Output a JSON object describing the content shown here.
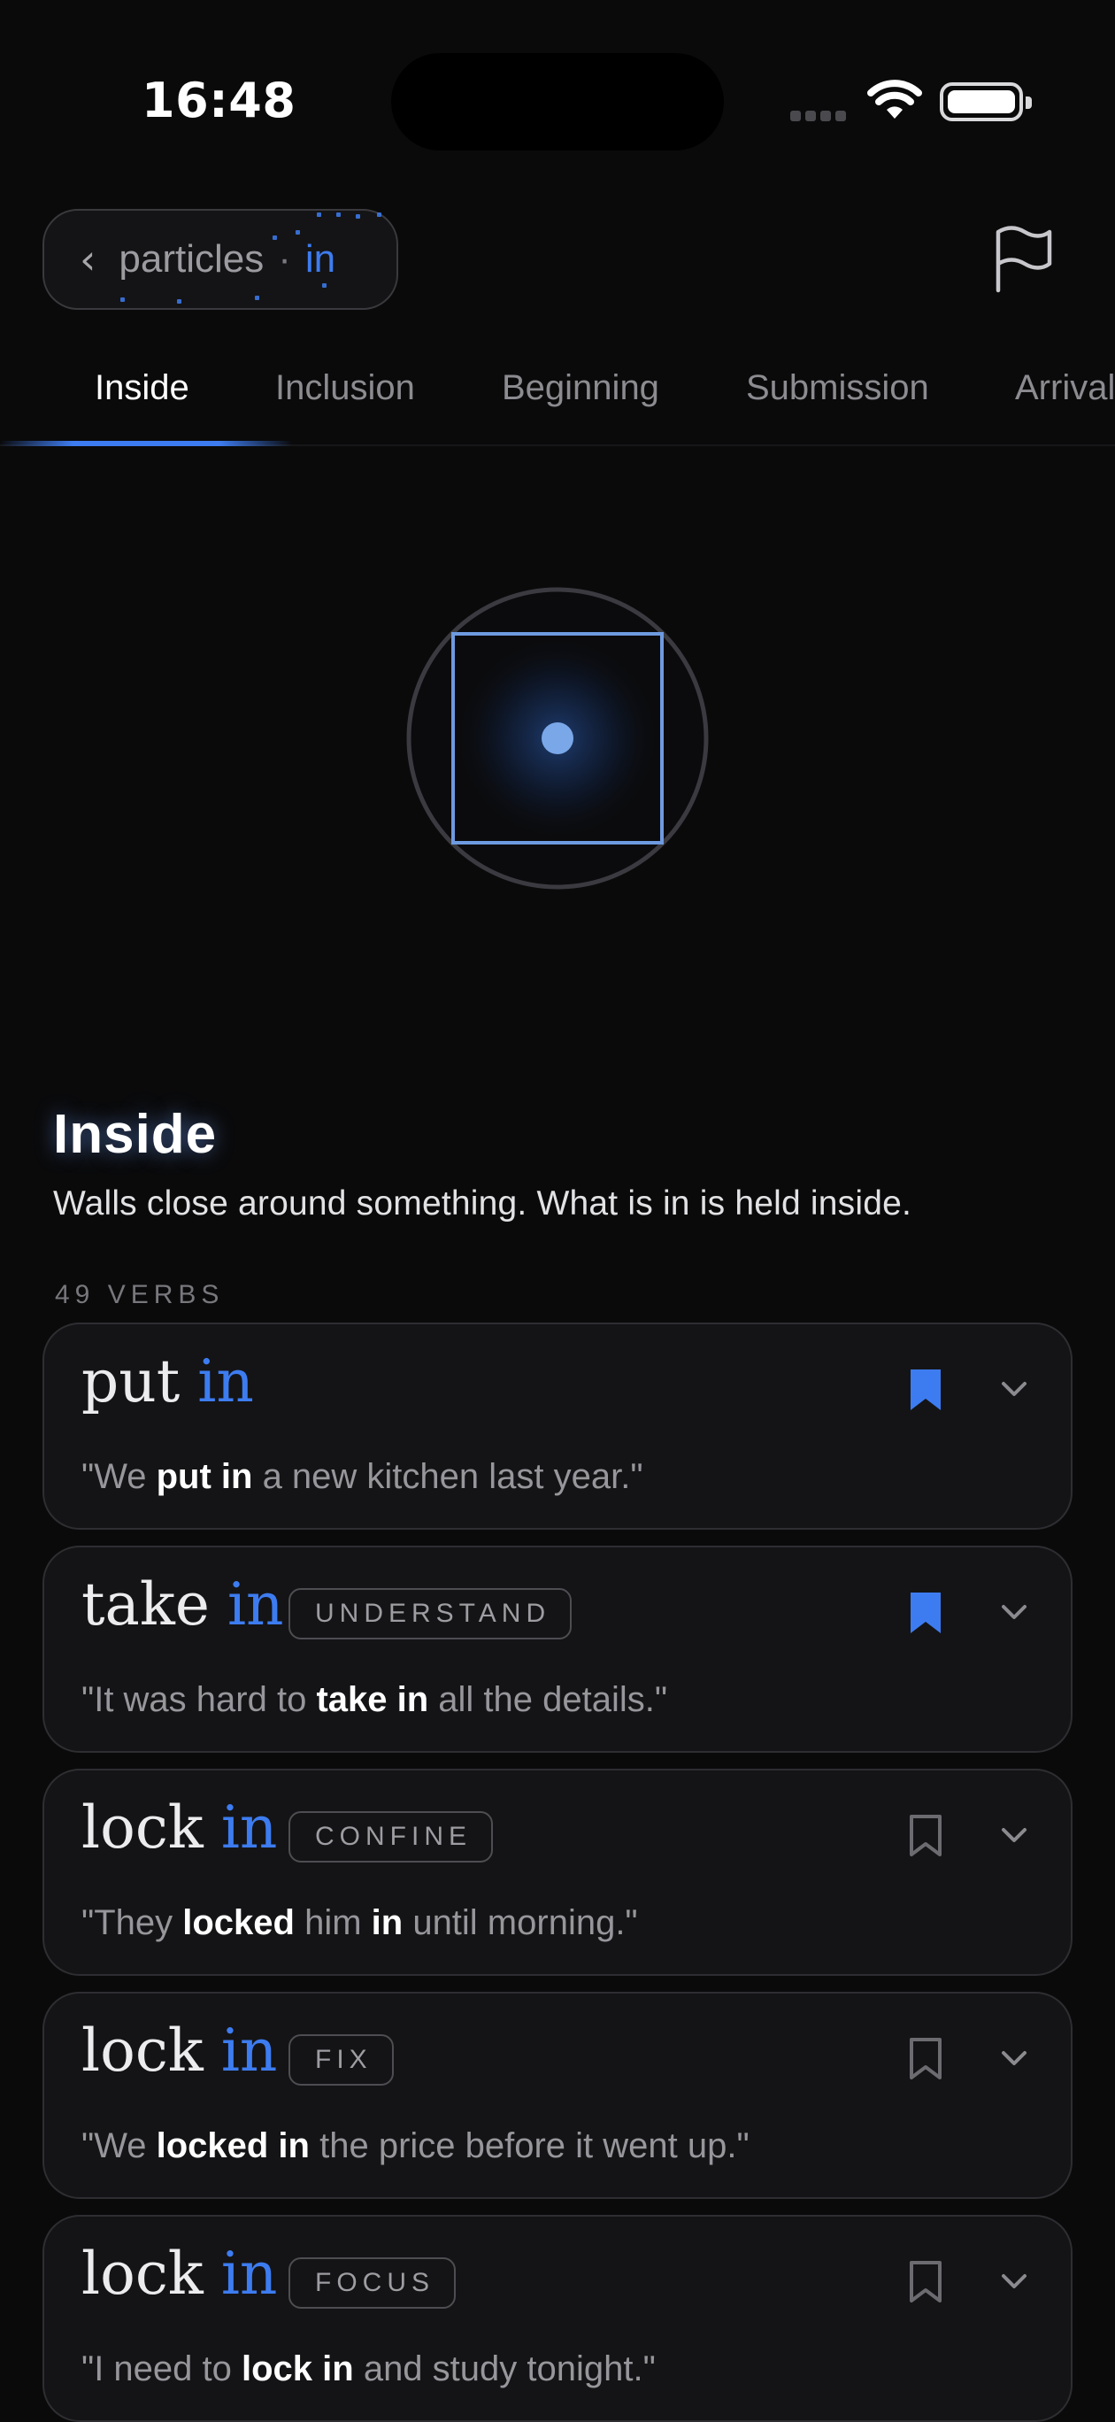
{
  "status": {
    "time": "16:48"
  },
  "nav": {
    "crumb_label": "particles",
    "crumb_separator": "·",
    "crumb_particle": "in"
  },
  "tabs": [
    {
      "label": "Inside",
      "active": true
    },
    {
      "label": "Inclusion",
      "active": false
    },
    {
      "label": "Beginning",
      "active": false
    },
    {
      "label": "Submission",
      "active": false
    },
    {
      "label": "Arrival",
      "active": false
    }
  ],
  "sense": {
    "title": "Inside",
    "description": "Walls close around something. What is in is held inside.",
    "verb_count": "49 VERBS"
  },
  "cards": [
    {
      "base": "put",
      "particle": "in",
      "tag": "",
      "bookmarked": true,
      "example": {
        "before": "\"We ",
        "bold1": "put in",
        "mid": " a new kitchen last year.\"",
        "bold2": "",
        "after": ""
      }
    },
    {
      "base": "take",
      "particle": "in",
      "tag": "UNDERSTAND",
      "bookmarked": true,
      "example": {
        "before": "\"It was hard to ",
        "bold1": "take in",
        "mid": " all the details.\"",
        "bold2": "",
        "after": ""
      }
    },
    {
      "base": "lock",
      "particle": "in",
      "tag": "CONFINE",
      "bookmarked": false,
      "example": {
        "before": "\"They ",
        "bold1": "locked",
        "mid": " him ",
        "bold2": "in",
        "after": " until morning.\""
      }
    },
    {
      "base": "lock",
      "particle": "in",
      "tag": "FIX",
      "bookmarked": false,
      "example": {
        "before": "\"We ",
        "bold1": "locked in",
        "mid": " the price before it went up.\"",
        "bold2": "",
        "after": ""
      }
    },
    {
      "base": "lock",
      "particle": "in",
      "tag": "FOCUS",
      "bookmarked": false,
      "example": {
        "before": "\"I need to ",
        "bold1": "lock in",
        "mid": " and study tonight.\"",
        "bold2": "",
        "after": ""
      }
    }
  ],
  "icons": {
    "back": "chevron-left-icon",
    "flag": "flag-icon",
    "bookmark": "bookmark-icon",
    "expand": "chevron-down-icon"
  },
  "colors": {
    "accent": "#3d7cf0",
    "background": "#0a0a0b",
    "card": "#141416",
    "muted": "#96969b"
  }
}
